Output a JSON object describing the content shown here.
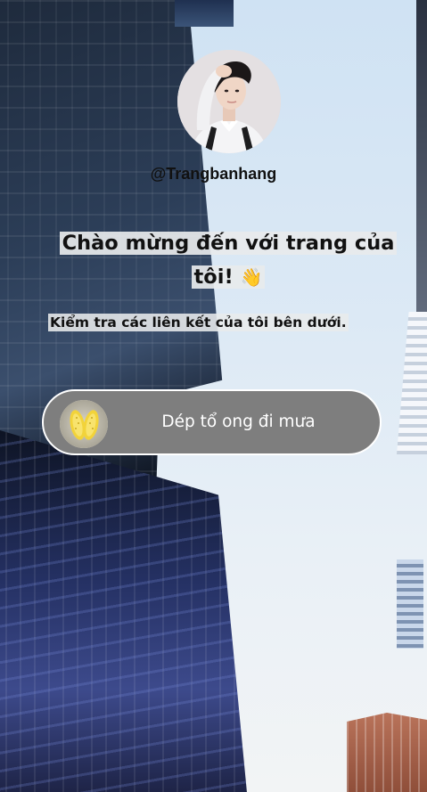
{
  "profile": {
    "username": "@Trangbanhang",
    "avatar_icon": "profile-photo"
  },
  "heading": {
    "text": "Chào mừng đến với trang của tôi!",
    "emoji": "👋"
  },
  "subheading": "Kiểm tra các liên kết của tôi bên dưới.",
  "links": [
    {
      "label": "Dép tổ ong đi mưa",
      "thumbnail_icon": "sandals-icon",
      "background_color": "#7e7e7e"
    }
  ]
}
